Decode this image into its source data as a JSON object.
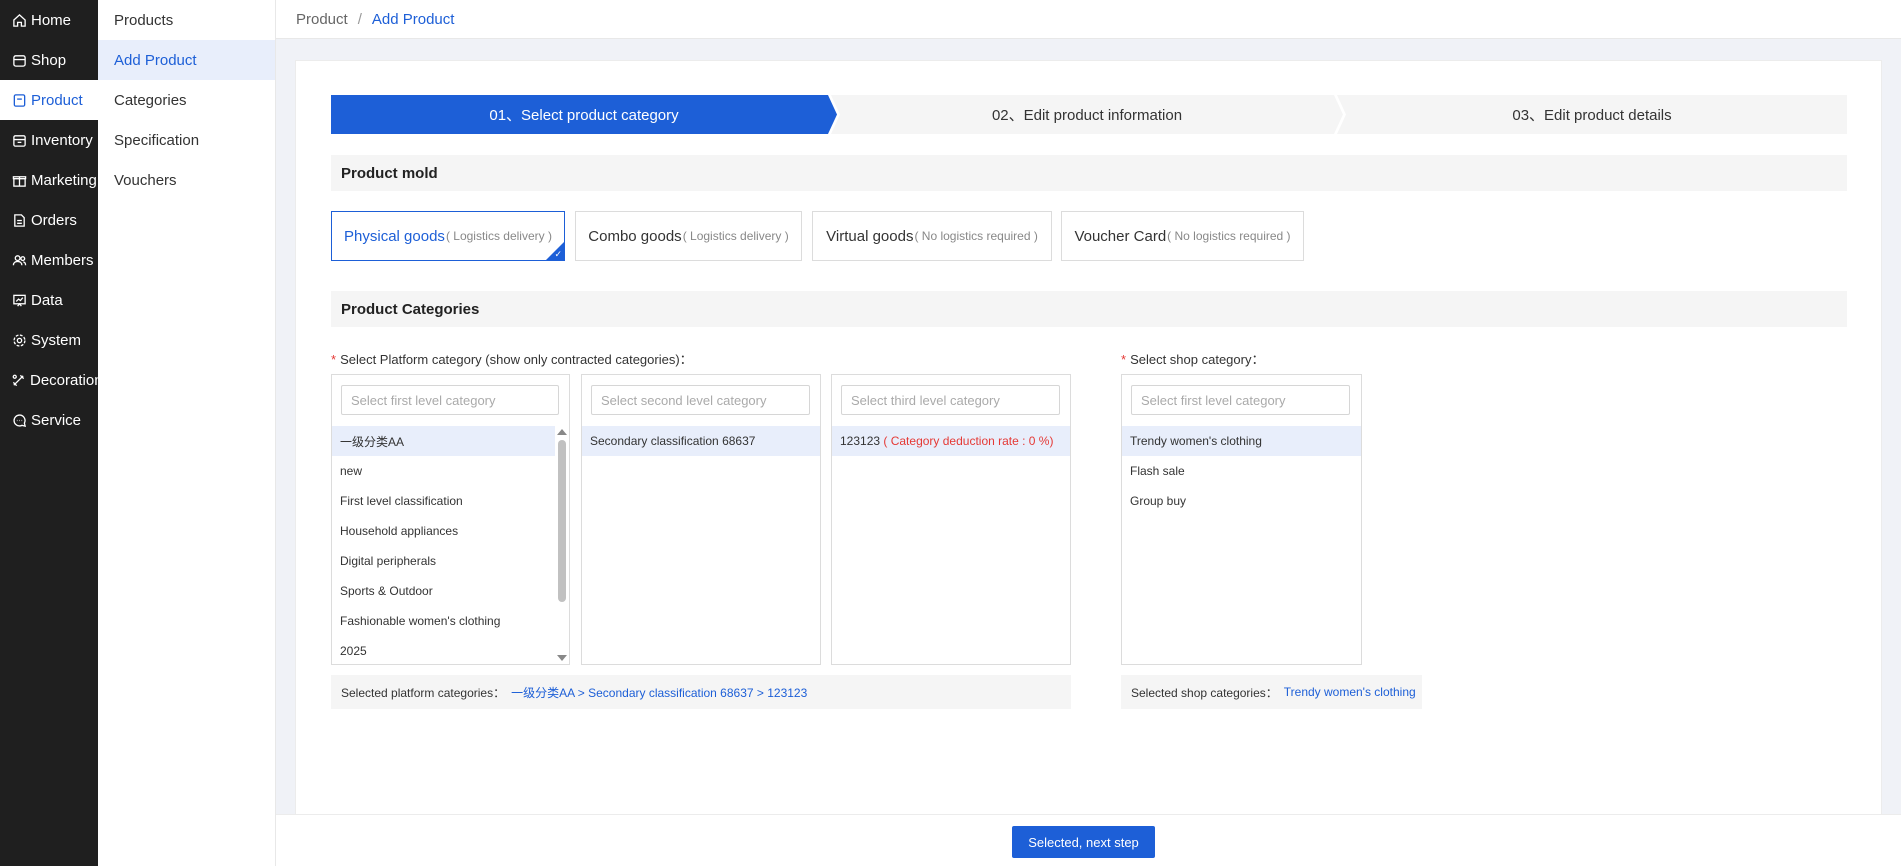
{
  "nav": {
    "items": [
      {
        "label": "Home",
        "icon": "home-icon"
      },
      {
        "label": "Shop",
        "icon": "shop-icon"
      },
      {
        "label": "Product",
        "icon": "product-icon"
      },
      {
        "label": "Inventory",
        "icon": "inventory-icon"
      },
      {
        "label": "Marketing",
        "icon": "gift-icon"
      },
      {
        "label": "Orders",
        "icon": "document-icon"
      },
      {
        "label": "Members",
        "icon": "members-icon"
      },
      {
        "label": "Data",
        "icon": "chart-icon"
      },
      {
        "label": "System",
        "icon": "gear-icon"
      },
      {
        "label": "Decoration",
        "icon": "decoration-icon"
      },
      {
        "label": "Service",
        "icon": "chat-icon"
      }
    ],
    "active": "Product"
  },
  "subnav": {
    "items": [
      "Products",
      "Add Product",
      "Categories",
      "Specification",
      "Vouchers"
    ],
    "active": "Add Product"
  },
  "breadcrumb": {
    "root": "Product",
    "separator": "/",
    "current": "Add Product"
  },
  "steps": [
    "01、Select product category",
    "02、Edit product information",
    "03、Edit product details"
  ],
  "mold": {
    "title": "Product mold",
    "options": [
      {
        "label": "Physical goods",
        "sub": "( Logistics delivery )"
      },
      {
        "label": "Combo goods",
        "sub": "( Logistics delivery )"
      },
      {
        "label": "Virtual goods",
        "sub": "( No logistics required )"
      },
      {
        "label": "Voucher Card",
        "sub": "( No logistics required )"
      }
    ],
    "selected": "Physical goods"
  },
  "categories": {
    "title": "Product Categories",
    "platform_label": "Select Platform category (show only contracted categories)：",
    "shop_label": "Select shop category：",
    "level1_placeholder": "Select first level category",
    "level2_placeholder": "Select second level category",
    "level3_placeholder": "Select third level category",
    "shop_placeholder": "Select first level category",
    "level1_items": [
      "一级分类AA",
      "new",
      "First level classification",
      "Household appliances",
      "Digital peripherals",
      "Sports & Outdoor",
      "Fashionable women's clothing",
      "2025"
    ],
    "level2_items": [
      "Secondary classification 68637"
    ],
    "level3_item": {
      "name": "123123",
      "rate": "( Category deduction rate : 0 %)"
    },
    "shop_items": [
      "Trendy women's clothing",
      "Flash sale",
      "Group buy"
    ],
    "selected_platform_label": "Selected platform categories：",
    "selected_platform_path": "一级分类AA >  Secondary classification 68637 >  123123",
    "selected_shop_label": "Selected shop categories：",
    "selected_shop_path": "Trendy women's clothing"
  },
  "footer": {
    "next_label": "Selected, next step"
  },
  "colors": {
    "accent": "#1d5fd7",
    "nav_bg": "#1f1f1f",
    "required": "#e53935"
  }
}
